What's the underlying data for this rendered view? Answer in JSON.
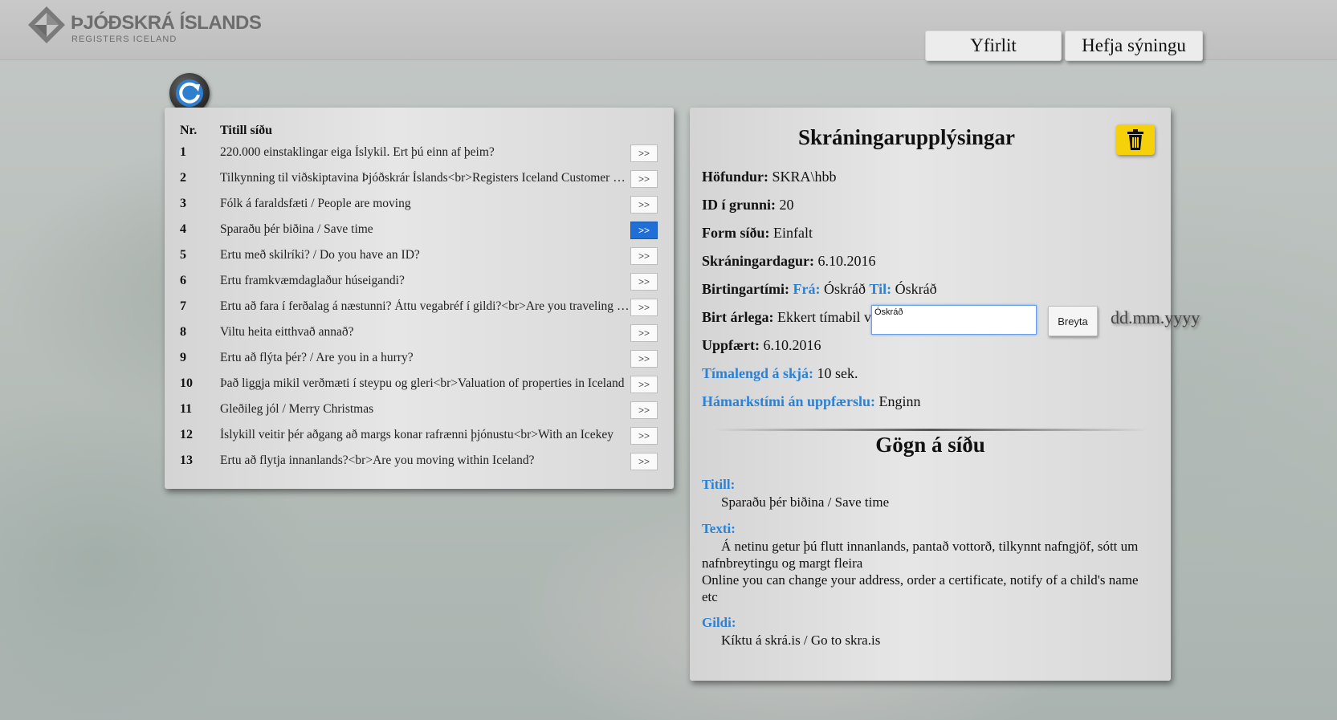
{
  "header": {
    "logo_title": "ÞJÓÐSKRÁ ÍSLANDS",
    "logo_subtitle": "REGISTERS ICELAND",
    "nav": [
      {
        "label": "Yfirlit"
      },
      {
        "label": "Hefja sýningu"
      }
    ]
  },
  "pages_table": {
    "col_nr": "Nr.",
    "col_title": "Titill síðu",
    "go_label": ">>",
    "selected_index": 3,
    "rows": [
      {
        "nr": "1",
        "title": "220.000 einstaklingar eiga Íslykil. Ert þú einn af þeim?"
      },
      {
        "nr": "2",
        "title": "Tilkynning til viðskiptavina Þjóðskrár Íslands<br>Registers Iceland Customer notice"
      },
      {
        "nr": "3",
        "title": "Fólk á faraldsfæti / People are moving"
      },
      {
        "nr": "4",
        "title": "Sparaðu þér biðina / Save time"
      },
      {
        "nr": "5",
        "title": "Ertu með skilríki? / Do you have an ID?"
      },
      {
        "nr": "6",
        "title": "Ertu framkvæmdaglaður húseigandi?"
      },
      {
        "nr": "7",
        "title": "Ertu að fara í ferðalag á næstunni? Áttu vegabréf í gildi?<br>Are you traveling soon?"
      },
      {
        "nr": "8",
        "title": "Viltu heita eitthvað annað?"
      },
      {
        "nr": "9",
        "title": "Ertu að flýta þér? / Are you in a hurry?"
      },
      {
        "nr": "10",
        "title": "Það liggja mikil verðmæti í steypu og gleri<br>Valuation of properties in Iceland"
      },
      {
        "nr": "11",
        "title": "Gleðileg jól / Merry Christmas"
      },
      {
        "nr": "12",
        "title": "Íslykill veitir þér aðgang að margs konar rafrænni þjónustu<br>With an Icekey"
      },
      {
        "nr": "13",
        "title": "Ertu að flytja innanlands?<br>Are you moving within Iceland?"
      }
    ]
  },
  "registration": {
    "title": "Skráningarupplýsingar",
    "author_label": "Höfundur:",
    "author": "SKRA\\hbb",
    "id_label": "ID í grunni:",
    "id": "20",
    "form_label": "Form síðu:",
    "form": "Einfalt",
    "created_label": "Skráningardagur:",
    "created": "6.10.2016",
    "pubtime_label": "Birtingartími:",
    "from_label": "Frá:",
    "from": "Óskráð",
    "to_label": "Til:",
    "to": "Óskráð",
    "yearly_label": "Birt árlega:",
    "yearly": "Ekkert tímabil v",
    "yearly_input_value": "Óskráð",
    "change_button": "Breyta",
    "date_hint": "dd.mm.yyyy",
    "updated_label": "Uppfært:",
    "updated": "6.10.2016",
    "screen_time_label": "Tímalengd á skjá:",
    "screen_time": "10 sek.",
    "max_time_label": "Hámarkstími án uppfærslu:",
    "max_time": "Enginn"
  },
  "content": {
    "title": "Gögn á síðu",
    "title_label": "Titill:",
    "title_value": "Sparaðu þér biðina / Save time",
    "text_label": "Texti:",
    "text_value_is": "Á netinu getur þú flutt innanlands, pantað vottorð, tilkynnt nafngjöf, sótt um nafnbreytingu og margt fleira",
    "text_value_en": "Online you can change your address, order a certificate, notify of a child's name etc",
    "value_label": "Gildi:",
    "value_value": "Kíktu á skrá.is / Go to skra.is"
  },
  "colors": {
    "accent_blue": "#2a82d6",
    "selected_button": "#1f6fd6",
    "trash_yellow": "#f4d10b"
  },
  "icons": [
    "refresh-icon",
    "trash-icon",
    "logo-mark-icon"
  ]
}
